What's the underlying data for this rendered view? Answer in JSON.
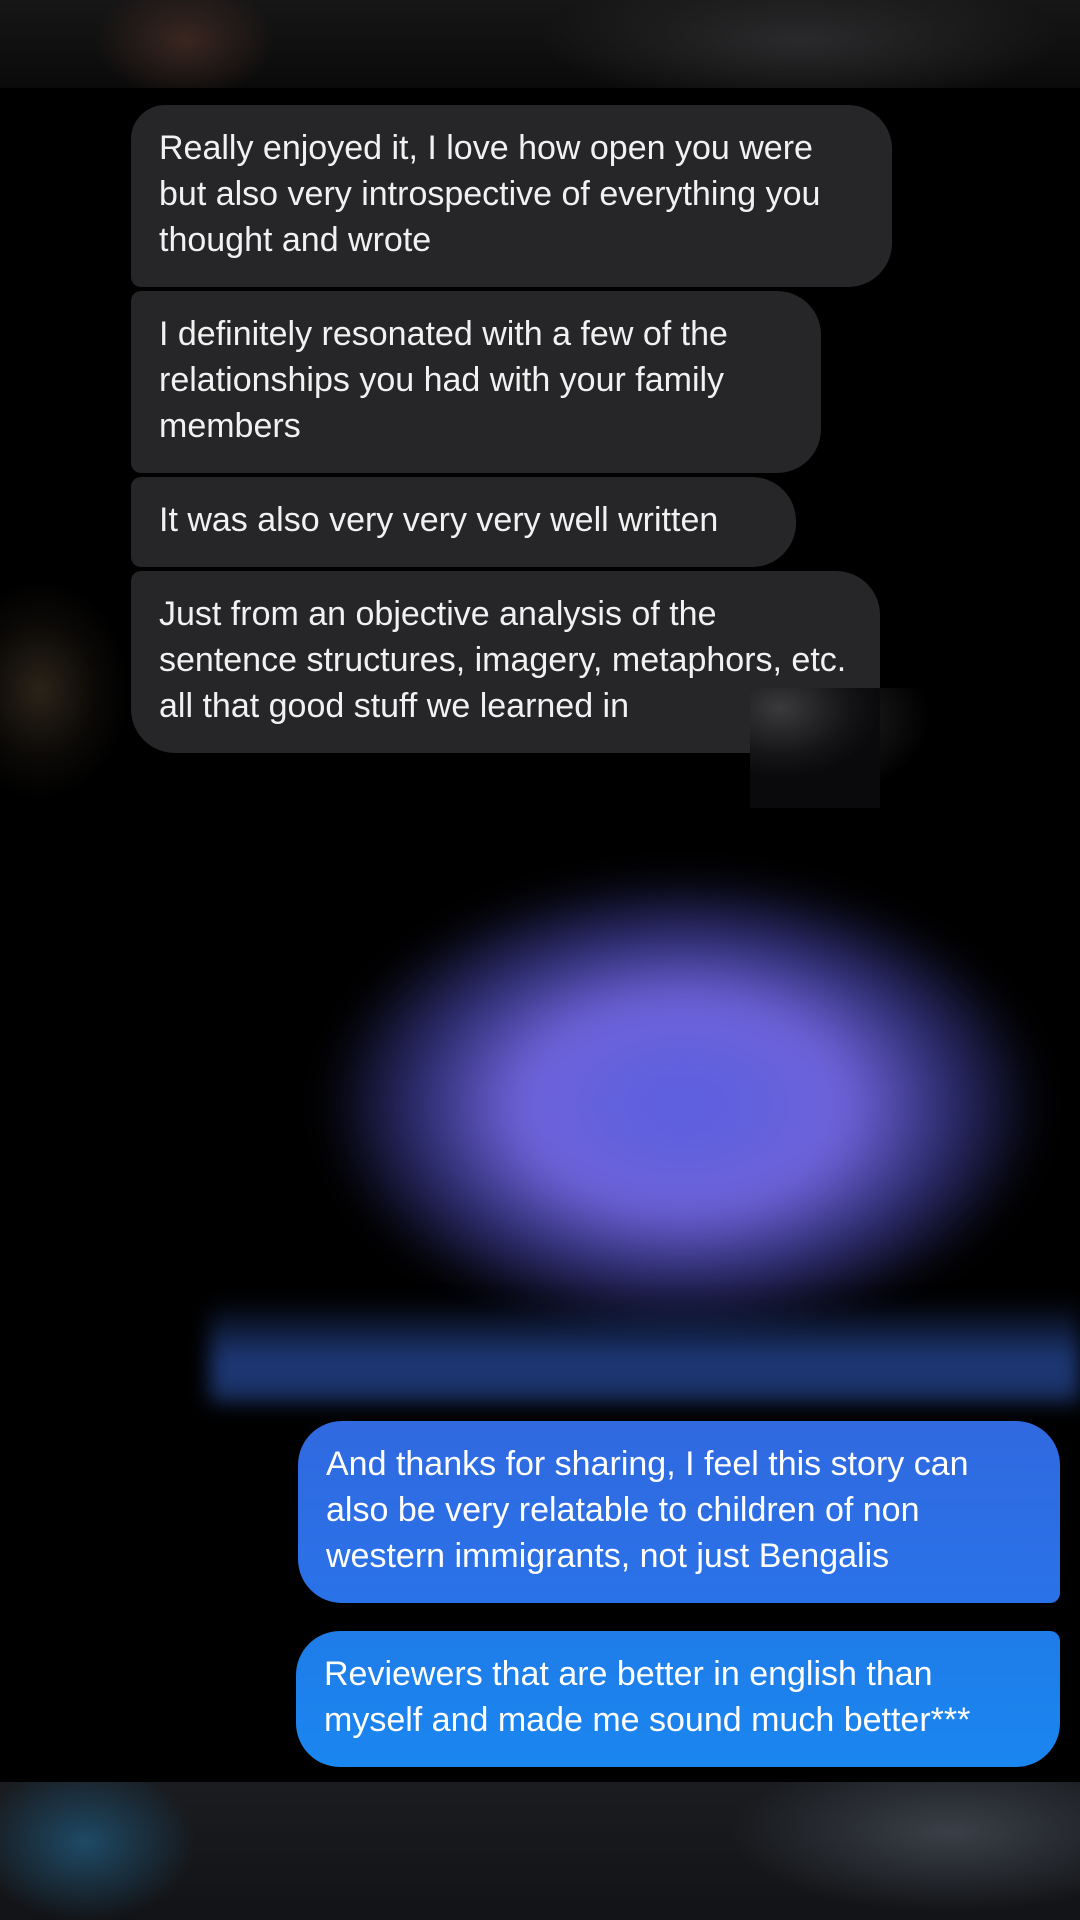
{
  "conversation": {
    "messages": [
      {
        "direction": "incoming",
        "text": "Really enjoyed it, I love how open you were but also very introspective of everything you thought and wrote"
      },
      {
        "direction": "incoming",
        "text": "I definitely resonated with a few of the relationships you had with your family members"
      },
      {
        "direction": "incoming",
        "text": "It was also very very very well written"
      },
      {
        "direction": "incoming",
        "text": "Just from an objective analysis of the sentence structures, imagery, metaphors, etc. all that good stuff we learned in"
      },
      {
        "direction": "outgoing",
        "text": "And thanks for sharing, I feel this story can also be very relatable to children of non western immigrants, not just Bengalis"
      },
      {
        "direction": "outgoing",
        "text": "Reviewers that are better in english than myself and made me sound much better***"
      }
    ]
  },
  "colors": {
    "background": "#000000",
    "incoming_bubble": "#262628",
    "outgoing_bubble": "#2a72e8",
    "outgoing_bubble_last": "#1a86f0",
    "text": "#f1f1f1"
  }
}
